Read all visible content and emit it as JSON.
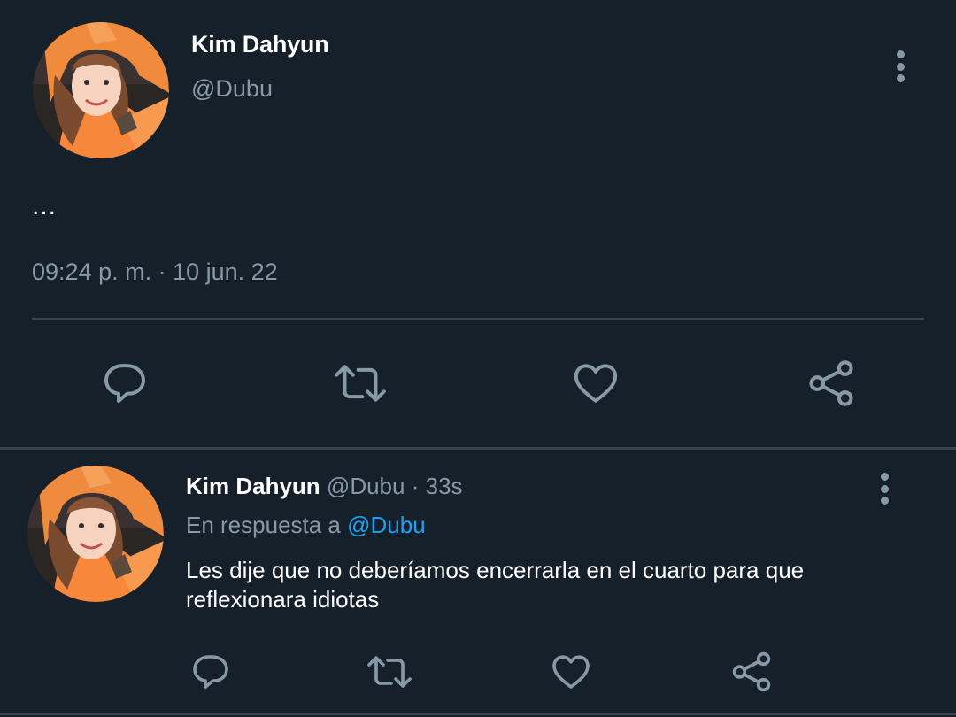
{
  "main_tweet": {
    "author_name": "Kim Dahyun",
    "author_handle": "@Dubu",
    "text": "...",
    "timestamp": "09:24 p. m. · 10 jun. 22",
    "actions": [
      "reply-icon",
      "retweet-icon",
      "like-icon",
      "share-icon"
    ],
    "menu_icon": "more-vertical-icon"
  },
  "reply_tweet": {
    "author_name": "Kim Dahyun",
    "author_handle": "@Dubu",
    "separator": "·",
    "time_ago": "33s",
    "reply_to_prefix": "En respuesta a",
    "reply_to_handle": "@Dubu",
    "text": "Les dije que no deberíamos encerrarla en el cuarto para que reflexionara idiotas",
    "actions": [
      "reply-icon",
      "retweet-icon",
      "like-icon",
      "share-icon"
    ],
    "menu_icon": "more-vertical-icon"
  },
  "colors": {
    "background": "#15202b",
    "secondary_text": "#8899a6",
    "divider": "#38444d",
    "link": "#1da1f2",
    "icon": "#8899a6"
  }
}
